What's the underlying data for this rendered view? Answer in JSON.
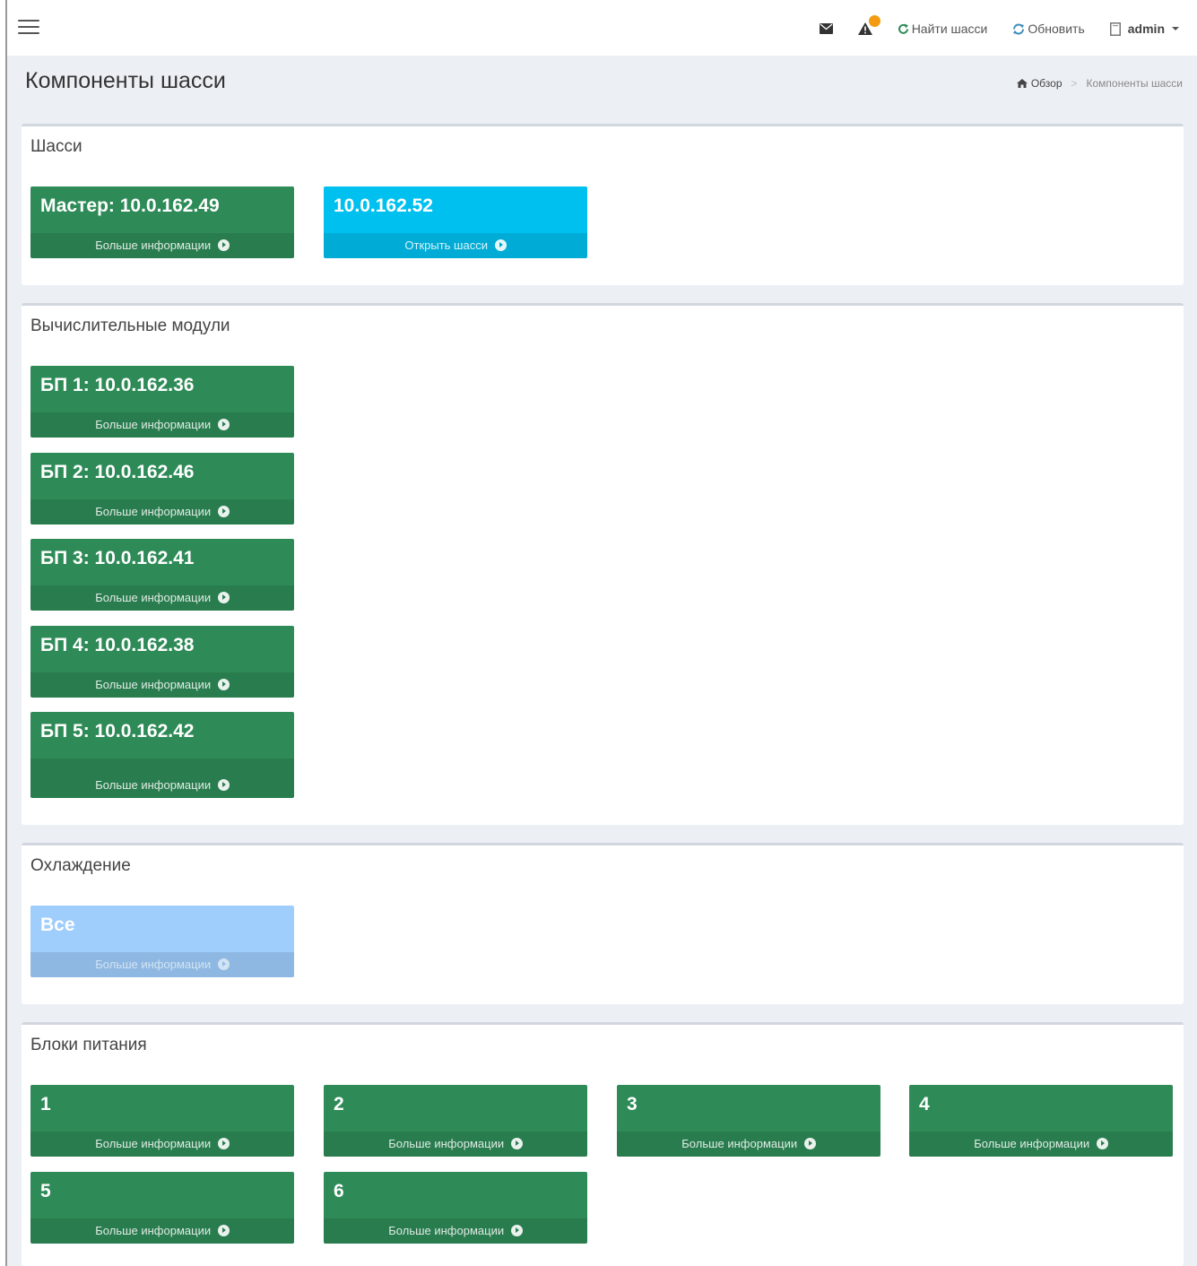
{
  "topbar": {
    "find_chassis": "Найти шасси",
    "refresh": "Обновить",
    "user": "admin",
    "colors": {
      "badge": "#f39c12",
      "refresh_icon": "#3c8dbc"
    }
  },
  "header": {
    "title": "Компоненты шасси",
    "breadcrumb": {
      "home": "Обзор",
      "current": "Компоненты шасси"
    }
  },
  "sections": {
    "chassis": {
      "title": "Шасси",
      "tiles": [
        {
          "title": "Мастер: 10.0.162.49",
          "footer": "Больше информации"
        },
        {
          "title": "10.0.162.52",
          "footer": "Открыть шасси"
        }
      ]
    },
    "compute": {
      "title": "Вычислительные модули",
      "tiles": [
        {
          "title": "БП 1: 10.0.162.36",
          "footer": "Больше информации"
        },
        {
          "title": "БП 2: 10.0.162.46",
          "footer": "Больше информации"
        },
        {
          "title": "БП 3: 10.0.162.41",
          "footer": "Больше информации"
        },
        {
          "title": "БП 4: 10.0.162.38",
          "footer": "Больше информации"
        },
        {
          "title": "БП 5: 10.0.162.42",
          "footer": "Больше информации"
        }
      ]
    },
    "cooling": {
      "title": "Охлаждение",
      "tiles": [
        {
          "title": "Все",
          "footer": "Больше информации"
        }
      ]
    },
    "power": {
      "title": "Блоки питания",
      "tiles": [
        {
          "title": "1",
          "footer": "Больше информации"
        },
        {
          "title": "2",
          "footer": "Больше информации"
        },
        {
          "title": "3",
          "footer": "Больше информации"
        },
        {
          "title": "4",
          "footer": "Больше информации"
        },
        {
          "title": "5",
          "footer": "Больше информации"
        },
        {
          "title": "6",
          "footer": "Больше информации"
        }
      ]
    }
  },
  "colors": {
    "green": "#2e8b57",
    "aqua": "#00c0ef",
    "light_blue": "#9fcdfc",
    "content_bg": "#ecf0f5"
  }
}
